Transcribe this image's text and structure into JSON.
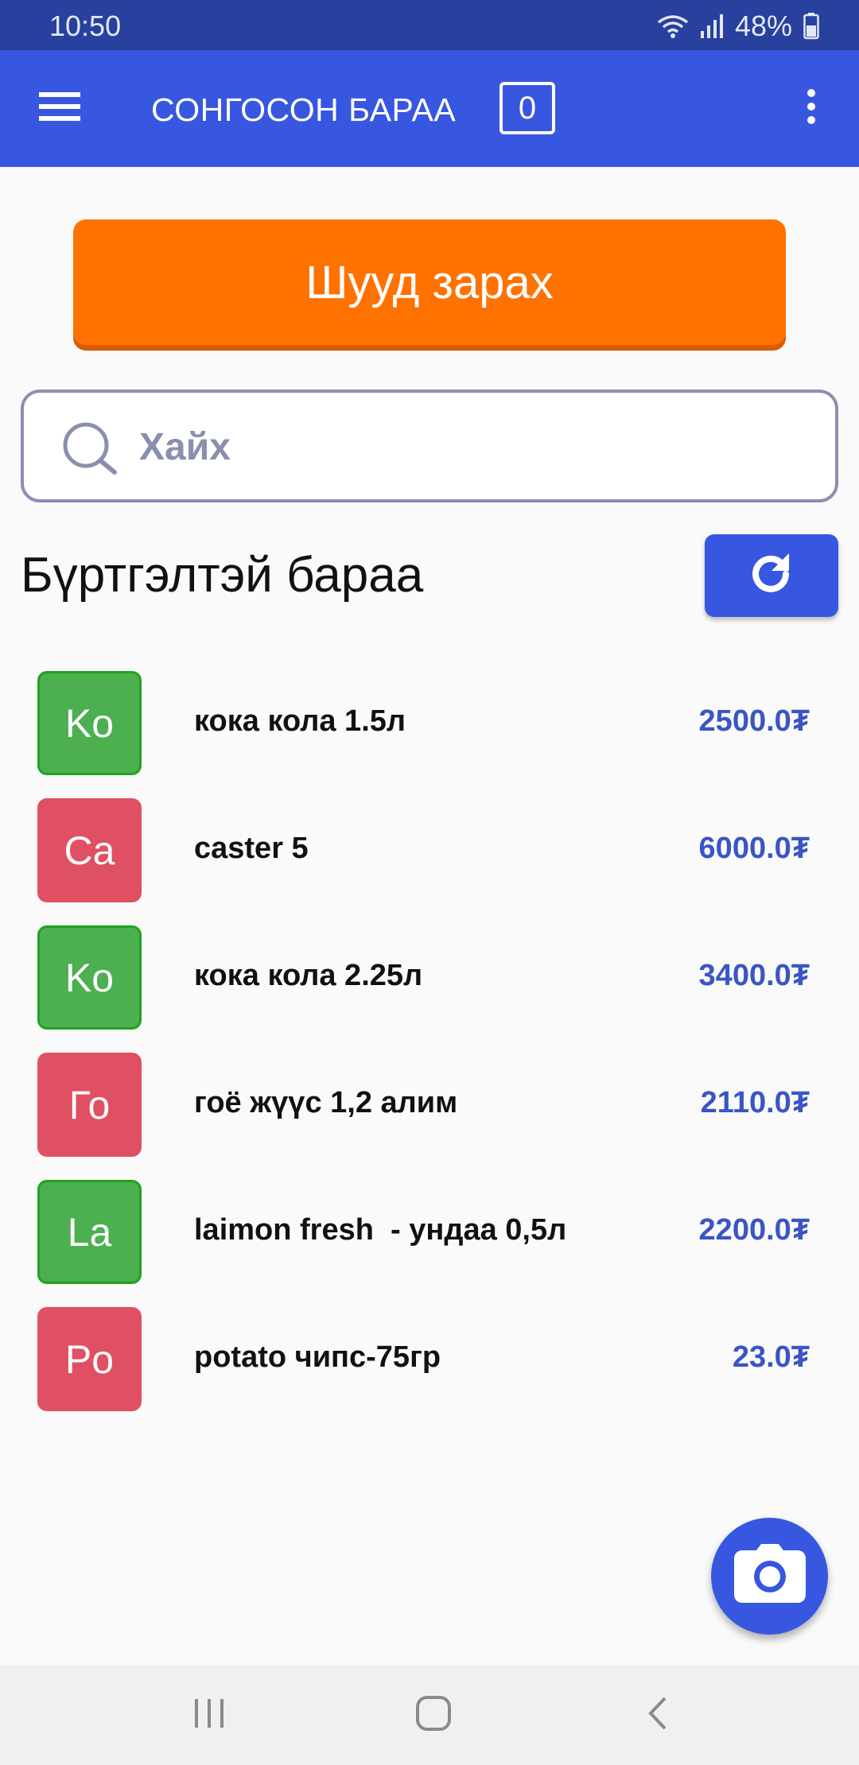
{
  "status_bar": {
    "time": "10:50",
    "battery": "48%",
    "icons": [
      "wifi-icon",
      "signal-icon",
      "battery-icon"
    ]
  },
  "app_bar": {
    "title": "СОНГОСОН БАРАА",
    "cart_count": "0",
    "icons": [
      "hamburger-menu-icon",
      "more-vertical-icon"
    ]
  },
  "actions": {
    "direct_sale_label": "Шууд зарах"
  },
  "search": {
    "placeholder": "Хайх",
    "value": ""
  },
  "section": {
    "title": "Бүртгэлтэй бараа"
  },
  "products": [
    {
      "initials": "Ko",
      "name": "кока кола 1.5л",
      "price": "2500.0₮",
      "color": "green"
    },
    {
      "initials": "Ca",
      "name": "caster 5",
      "price": "6000.0₮",
      "color": "red"
    },
    {
      "initials": "Ko",
      "name": "кока кола 2.25л",
      "price": "3400.0₮",
      "color": "green"
    },
    {
      "initials": "Го",
      "name": "гоё жүүс 1,2 алим",
      "price": "2110.0₮",
      "color": "red"
    },
    {
      "initials": "La",
      "name": "laimon fresh  - ундаа 0,5л",
      "price": "2200.0₮",
      "color": "green"
    },
    {
      "initials": "Po",
      "name": "potato чипс-75гр",
      "price": "23.0₮",
      "color": "red"
    }
  ],
  "colors": {
    "primary": "#3757e0",
    "status_bar": "#28409e",
    "accent_orange": "#ff7200",
    "avatar_green": "#4caf50",
    "avatar_green_border": "#1fa31f",
    "avatar_red": "#e05063",
    "price": "#3a55c4"
  }
}
